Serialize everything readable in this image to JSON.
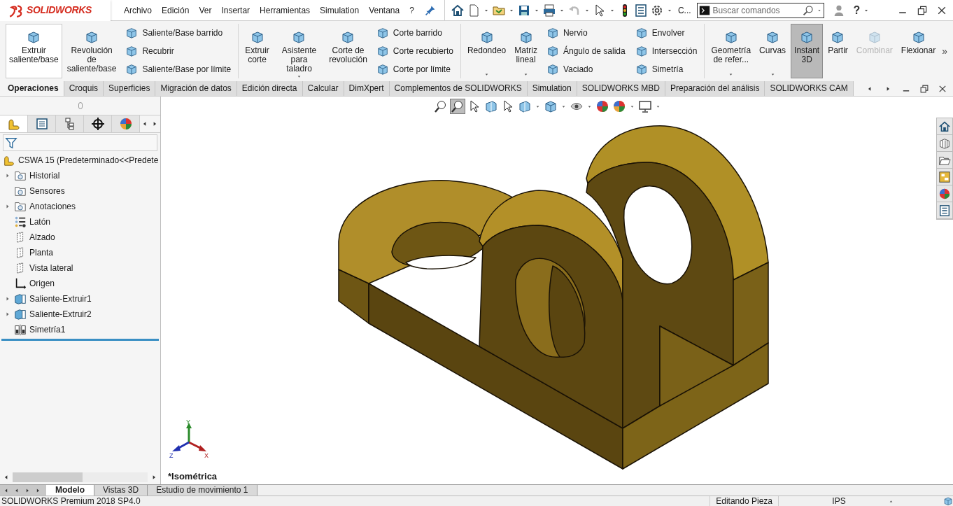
{
  "title_bar": {
    "logo": "SOLIDWORKS",
    "menus": [
      "Archivo",
      "Edición",
      "Ver",
      "Insertar",
      "Herramientas",
      "Simulation",
      "Ventana",
      "?"
    ],
    "overflow": "C...",
    "search": {
      "placeholder": "Buscar comandos"
    },
    "help": "?"
  },
  "ribbon": {
    "sections": [
      [
        {
          "kind": "large",
          "label": "Extruir\nsaliente/base",
          "hovered": true,
          "pressed": false,
          "disabled": false,
          "has_menu": false
        },
        {
          "kind": "large",
          "label": "Revolución\nde\nsaliente/base",
          "hovered": false,
          "pressed": false,
          "disabled": false,
          "has_menu": false
        },
        {
          "kind": "stack",
          "items": [
            "Saliente/Base barrido",
            "Recubrir",
            "Saliente/Base por límite"
          ]
        }
      ],
      [
        {
          "kind": "large",
          "label": "Extruir\ncorte",
          "hovered": false,
          "pressed": false,
          "disabled": false,
          "has_menu": false
        },
        {
          "kind": "large",
          "label": "Asistente\npara taladro",
          "hovered": false,
          "pressed": false,
          "disabled": false,
          "has_menu": true
        },
        {
          "kind": "large",
          "label": "Corte de\nrevolución",
          "hovered": false,
          "pressed": false,
          "disabled": false,
          "has_menu": false
        },
        {
          "kind": "stack",
          "items": [
            "Corte barrido",
            "Corte recubierto",
            "Corte por límite"
          ]
        }
      ],
      [
        {
          "kind": "large",
          "label": "Redondeo",
          "hovered": false,
          "pressed": false,
          "disabled": false,
          "has_menu": true
        },
        {
          "kind": "large",
          "label": "Matriz\nlineal",
          "hovered": false,
          "pressed": false,
          "disabled": false,
          "has_menu": true
        },
        {
          "kind": "stack",
          "items": [
            "Nervio",
            "Ángulo de salida",
            "Vaciado"
          ]
        },
        {
          "kind": "stack",
          "items": [
            "Envolver",
            "Intersección",
            "Simetría"
          ]
        }
      ],
      [
        {
          "kind": "large",
          "label": "Geometría\nde refer...",
          "hovered": false,
          "pressed": false,
          "disabled": false,
          "has_menu": true
        },
        {
          "kind": "large",
          "label": "Curvas",
          "hovered": false,
          "pressed": false,
          "disabled": false,
          "has_menu": true
        },
        {
          "kind": "large",
          "label": "Instant\n3D",
          "hovered": false,
          "pressed": true,
          "disabled": false,
          "has_menu": false
        },
        {
          "kind": "large",
          "label": "Partir",
          "hovered": false,
          "pressed": false,
          "disabled": false,
          "has_menu": false
        },
        {
          "kind": "large",
          "label": "Combinar",
          "hovered": false,
          "pressed": false,
          "disabled": true,
          "has_menu": false
        },
        {
          "kind": "large",
          "label": "Flexionar",
          "hovered": false,
          "pressed": false,
          "disabled": false,
          "has_menu": false
        }
      ]
    ],
    "more": "»"
  },
  "command_tabs": [
    {
      "label": "Operaciones",
      "selected": true
    },
    {
      "label": "Croquis",
      "selected": false
    },
    {
      "label": "Superficies",
      "selected": false
    },
    {
      "label": "Migración de datos",
      "selected": false
    },
    {
      "label": "Edición directa",
      "selected": false
    },
    {
      "label": "Calcular",
      "selected": false
    },
    {
      "label": "DimXpert",
      "selected": false
    },
    {
      "label": "Complementos de SOLIDWORKS",
      "selected": false
    },
    {
      "label": "Simulation",
      "selected": false
    },
    {
      "label": "SOLIDWORKS MBD",
      "selected": false
    },
    {
      "label": "Preparación del análisis",
      "selected": false
    },
    {
      "label": "SOLIDWORKS CAM",
      "selected": false
    }
  ],
  "feature_tree": {
    "root": "CSWA 15  (Predeterminado<<Predete",
    "items": [
      {
        "label": "Historial",
        "kind": "folder",
        "expandable": true
      },
      {
        "label": "Sensores",
        "kind": "folder",
        "expandable": false
      },
      {
        "label": "Anotaciones",
        "kind": "folder",
        "expandable": true
      },
      {
        "label": "Latón",
        "kind": "material",
        "expandable": false
      },
      {
        "label": "Alzado",
        "kind": "plane",
        "expandable": false
      },
      {
        "label": "Planta",
        "kind": "plane",
        "expandable": false
      },
      {
        "label": "Vista lateral",
        "kind": "plane",
        "expandable": false
      },
      {
        "label": "Origen",
        "kind": "origin",
        "expandable": false
      },
      {
        "label": "Saliente-Extruir1",
        "kind": "feature",
        "expandable": true
      },
      {
        "label": "Saliente-Extruir2",
        "kind": "feature",
        "expandable": true
      },
      {
        "label": "Simetría1",
        "kind": "mirror",
        "expandable": false
      }
    ]
  },
  "viewport": {
    "triad": [
      "Y",
      "X",
      "Z"
    ],
    "view_name": "*Isométrica"
  },
  "bottom_tabs": [
    {
      "label": "Modelo",
      "selected": true
    },
    {
      "label": "Vistas 3D",
      "selected": false
    },
    {
      "label": "Estudio de movimiento 1",
      "selected": false
    }
  ],
  "status_bar": {
    "product": "SOLIDWORKS Premium 2018 SP4.0",
    "mode": "Editando Pieza",
    "units": "IPS"
  }
}
